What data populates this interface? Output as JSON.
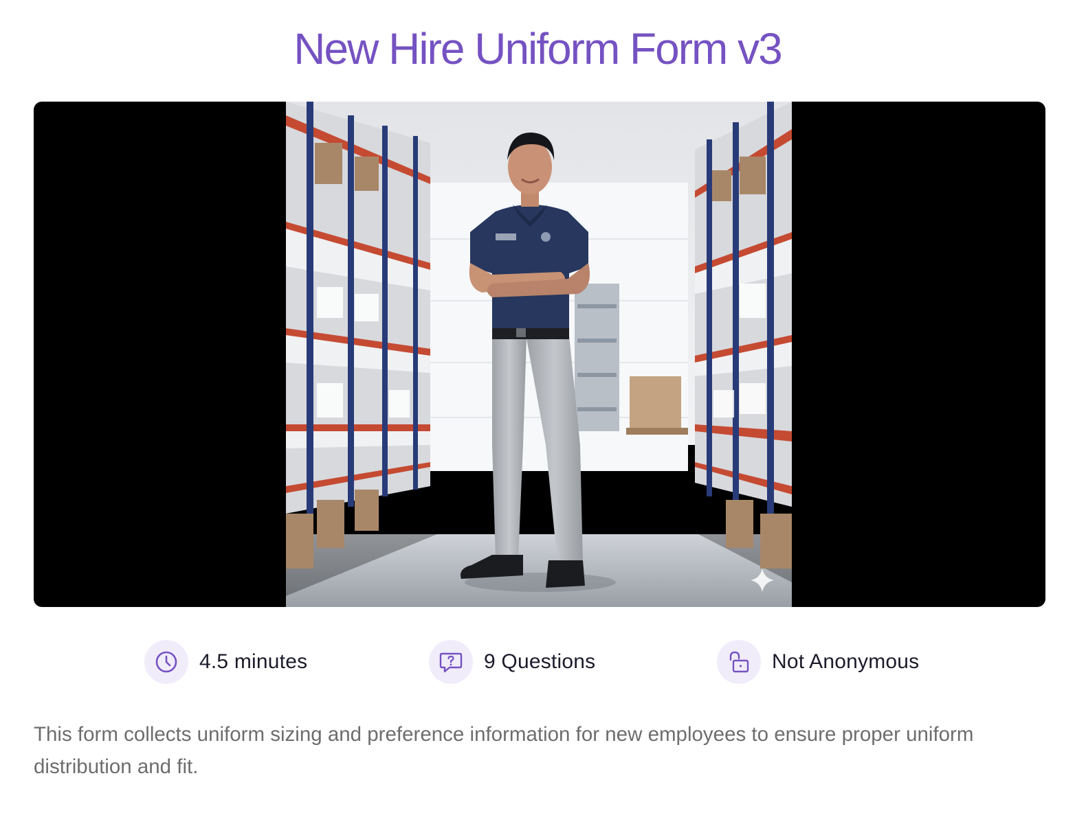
{
  "form": {
    "title": "New Hire Uniform Form v3",
    "description": "This form collects uniform sizing and preference information for new employees to ensure proper uniform distribution and fit."
  },
  "hero_image": {
    "subject": "employee-in-uniform-warehouse-photo",
    "overlay_icon": "sparkle-icon"
  },
  "meta": {
    "duration": {
      "icon": "clock-icon",
      "label": "4.5 minutes"
    },
    "questions": {
      "icon": "question-bubble-icon",
      "label": "9 Questions"
    },
    "anonymity": {
      "icon": "unlocked-icon",
      "label": "Not Anonymous"
    }
  },
  "colors": {
    "accent": "#7552c2",
    "icon_bg": "#f1ecfa",
    "body_text": "#1b1b2b",
    "muted_text": "#6d6d6d",
    "hero_bg": "#000000"
  }
}
